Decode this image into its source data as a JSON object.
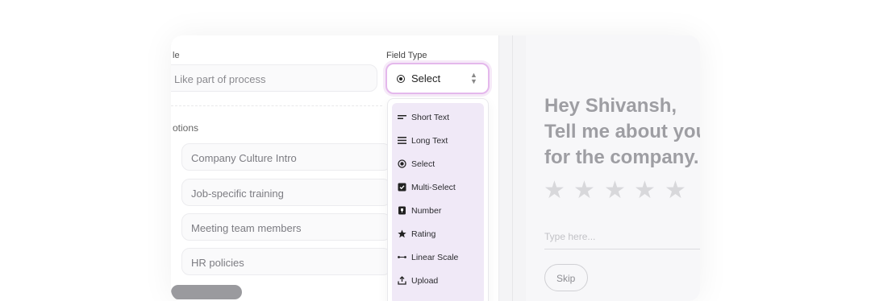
{
  "form": {
    "title_label": "le",
    "title_value": "Like part of process",
    "field_type_label": "Field Type",
    "field_type_value": "Select",
    "options_label": "otions",
    "options": [
      "Company Culture Intro",
      "Job-specific training",
      "Meeting team members",
      "HR policies"
    ]
  },
  "dropdown": {
    "items": [
      {
        "label": "Short Text",
        "icon": "short-text-icon"
      },
      {
        "label": "Long Text",
        "icon": "long-text-icon"
      },
      {
        "label": "Select",
        "icon": "radio-icon"
      },
      {
        "label": "Multi-Select",
        "icon": "checkbox-icon"
      },
      {
        "label": "Number",
        "icon": "number-icon"
      },
      {
        "label": "Rating",
        "icon": "star-icon"
      },
      {
        "label": "Linear Scale",
        "icon": "linear-scale-icon"
      },
      {
        "label": "Upload",
        "icon": "upload-icon"
      }
    ]
  },
  "preview": {
    "line1": "Hey Shivansh,",
    "line2": "Tell me about your",
    "line3": "for the company.",
    "stars": 5,
    "rating_value": 0,
    "input_placeholder": "Type here...",
    "skip_label": "Skip"
  },
  "colors": {
    "accent_border": "#e4b8ec",
    "dropdown_bg": "#f0e9f7",
    "heading_text": "#9e9ea3"
  }
}
